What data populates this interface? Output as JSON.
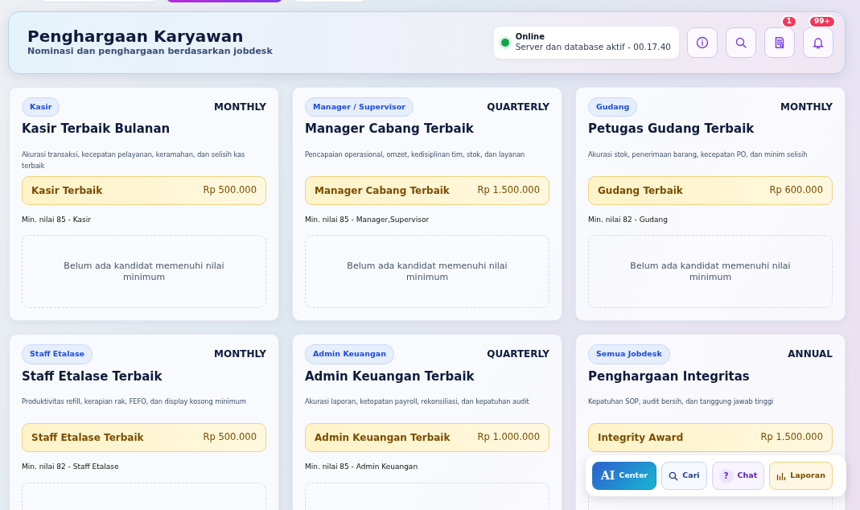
{
  "top_tabs": [
    {
      "selected": false
    },
    {
      "selected": true
    },
    {
      "selected": false
    }
  ],
  "header": {
    "title": "Penghargaan Karyawan",
    "subtitle": "Nominasi dan penghargaan berdasarkan jobdesk",
    "status": {
      "label": "Online",
      "detail": "Server dan database aktif - 00.17.40",
      "color": "#16a34a"
    },
    "actions": [
      {
        "kind": "info"
      },
      {
        "kind": "search"
      },
      {
        "kind": "document",
        "badge": "1"
      },
      {
        "kind": "bell",
        "badge": "99+"
      }
    ]
  },
  "awards": [
    {
      "tag": "Kasir",
      "period": "MONTHLY",
      "title": "Kasir Terbaik Bulanan",
      "description": "Akurasi transaksi, kecepatan pelayanan, keramahan, dan selisih kas terbaik",
      "prize_name": "Kasir Terbaik",
      "prize_amount": "Rp 500.000",
      "requirement": "Min. nilai 85 - Kasir",
      "empty_text": "Belum ada kandidat memenuhi nilai minimum"
    },
    {
      "tag": "Manager / Supervisor",
      "period": "QUARTERLY",
      "title": "Manager Cabang Terbaik",
      "description": "Pencapaian operasional, omzet, kedisiplinan tim, stok, dan layanan",
      "prize_name": "Manager Cabang Terbaik",
      "prize_amount": "Rp 1.500.000",
      "requirement": "Min. nilai 85 - Manager,Supervisor",
      "empty_text": "Belum ada kandidat memenuhi nilai minimum"
    },
    {
      "tag": "Gudang",
      "period": "MONTHLY",
      "title": "Petugas Gudang Terbaik",
      "description": "Akurasi stok, penerimaan barang, kecepatan PO, dan minim selisih",
      "prize_name": "Gudang Terbaik",
      "prize_amount": "Rp 600.000",
      "requirement": "Min. nilai 82 - Gudang",
      "empty_text": "Belum ada kandidat memenuhi nilai minimum"
    },
    {
      "tag": "Staff Etalase",
      "period": "MONTHLY",
      "title": "Staff Etalase Terbaik",
      "description": "Produktivitas refill, kerapian rak, FEFO, dan display kosong minimum",
      "prize_name": "Staff Etalase Terbaik",
      "prize_amount": "Rp 500.000",
      "requirement": "Min. nilai 82 - Staff Etalase"
    },
    {
      "tag": "Admin Keuangan",
      "period": "QUARTERLY",
      "title": "Admin Keuangan Terbaik",
      "description": "Akurasi laporan, ketepatan payroll, rekonsiliasi, dan kepatuhan audit",
      "prize_name": "Admin Keuangan Terbaik",
      "prize_amount": "Rp 1.000.000",
      "requirement": "Min. nilai 85 - Admin Keuangan"
    },
    {
      "tag": "Semua Jobdesk",
      "period": "ANNUAL",
      "title": "Penghargaan Integritas",
      "description": "Kepatuhan SOP, audit bersih, dan tanggung jawab tinggi",
      "prize_name": "Integrity Award",
      "prize_amount": "Rp 1.500.000"
    }
  ],
  "dock": [
    {
      "kind": "ai",
      "mark": "AI",
      "label": "Center"
    },
    {
      "kind": "search",
      "label": "Cari"
    },
    {
      "kind": "chat",
      "mark": "?",
      "label": "Chat"
    },
    {
      "kind": "report",
      "label": "Laporan"
    }
  ]
}
